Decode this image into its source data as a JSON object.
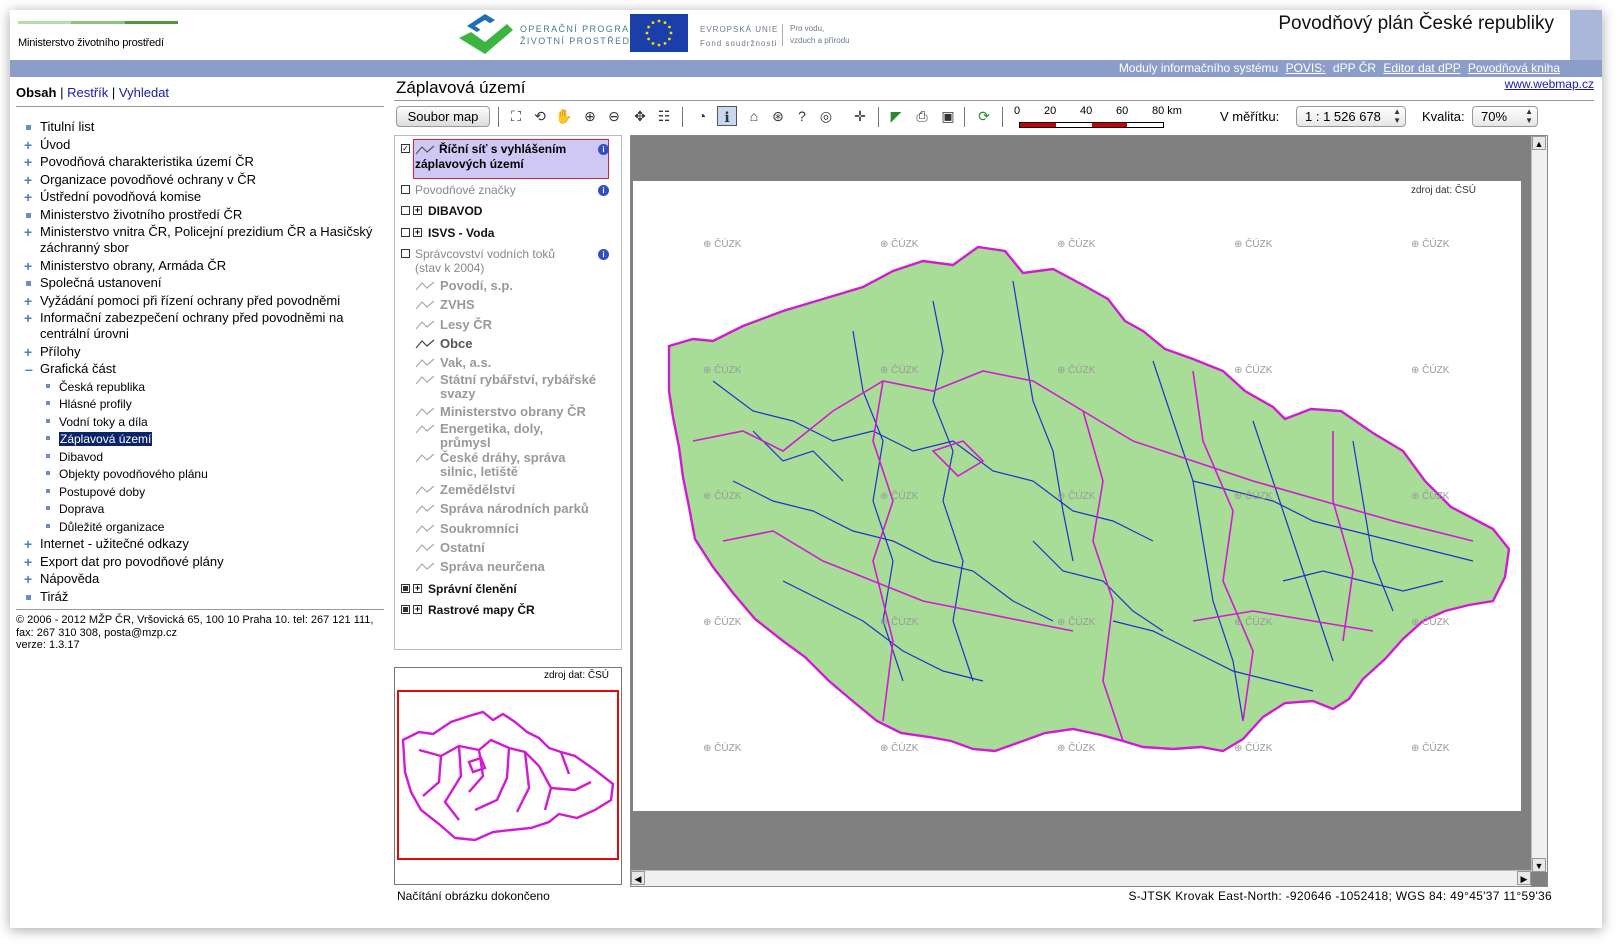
{
  "header": {
    "ministry_name": "Ministerstvo životního prostředí",
    "op_line1": "OPERAČNÍ PROGRAM",
    "op_line2": "ŽIVOTNÍ PROSTŘEDÍ",
    "eu_line1": "EVROPSKÁ UNIE",
    "eu_line2": "Fond soudržnosti",
    "eu_motto1": "Pro vodu,",
    "eu_motto2": "vzduch a přírodu",
    "app_title": "Povodňový plán České republiky",
    "colors": {
      "ministry_green": "#6ab04c",
      "nav_bar": "#8b9dc8",
      "eu_blue": "#1b3fa8"
    }
  },
  "topnav": {
    "prefix": "Moduly informačního systému",
    "povis": "POVIS:",
    "dpp": "dPP ČR",
    "editor": "Editor dat dPP",
    "kniha": "Povodňová kniha",
    "webmap": "www.webmap.cz"
  },
  "leftnav": {
    "tab_active": "Obsah",
    "sep": "|",
    "tab_restrik": "Restřík",
    "tab_search": "Vyhledat",
    "items": [
      {
        "label": "Titulní list",
        "marker": "bullet"
      },
      {
        "label": "Úvod",
        "marker": "plus"
      },
      {
        "label": "Povodňová charakteristika území ČR",
        "marker": "plus"
      },
      {
        "label": "Organizace povodňové ochrany v ČR",
        "marker": "plus"
      },
      {
        "label": "Ústřední povodňová komise",
        "marker": "plus"
      },
      {
        "label": "Ministerstvo životního prostředí ČR",
        "marker": "bullet"
      },
      {
        "label": "Ministerstvo vnitra ČR, Policejní prezidium ČR a Hasičský záchranný sbor",
        "marker": "plus"
      },
      {
        "label": "Ministerstvo obrany, Armáda ČR",
        "marker": "plus"
      },
      {
        "label": "Společná ustanovení",
        "marker": "bullet"
      },
      {
        "label": "Vyžádání pomoci při řízení ochrany před povodněmi",
        "marker": "plus"
      },
      {
        "label": "Informační zabezpečení ochrany před povodněmi na centrální úrovni",
        "marker": "plus"
      },
      {
        "label": "Přílohy",
        "marker": "plus"
      },
      {
        "label": "Grafická část",
        "marker": "minus"
      }
    ],
    "subitems": [
      "Česká republika",
      "Hlásné profily",
      "Vodní toky a díla",
      "Záplavová území",
      "Dibavod",
      "Objekty povodňového plánu",
      "Postupové doby",
      "Doprava",
      "Důležité organizace"
    ],
    "items_after": [
      {
        "label": "Internet - užitečné odkazy",
        "marker": "plus"
      },
      {
        "label": "Export dat pro povodňové plány",
        "marker": "plus"
      },
      {
        "label": "Nápověda",
        "marker": "plus"
      },
      {
        "label": "Tiráž",
        "marker": "bullet"
      }
    ],
    "footer_line1": "© 2006 - 2012 MŽP ČR, Vršovická 65, 100 10 Praha 10. tel: 267 121 111,",
    "footer_line2": "fax: 267 310 308, posta@mzp.cz",
    "footer_line3": "verze: 1.3.17"
  },
  "main": {
    "title": "Záplavová území",
    "soubor_map": "Soubor map",
    "scale_labels": [
      "0",
      "20",
      "40",
      "60",
      "80 km"
    ],
    "scale_label_lbl": "V měřítku:",
    "scale_value": "1 : 1 526 678",
    "quality_lbl": "Kvalita:",
    "quality_value": "70%"
  },
  "layers": {
    "rows": [
      {
        "label_1": "Říční síť s vyhlášením",
        "label_2": "záplavových území"
      },
      {
        "label": "Povodňové značky"
      },
      {
        "label": "DIBAVOD"
      },
      {
        "label": "ISVS - Voda"
      },
      {
        "label_1": "Správcovství vodních toků",
        "label_2": "(stav k 2004)"
      }
    ],
    "sub": [
      "Povodí, s.p.",
      "ZVHS",
      "Lesy ČR",
      "Obce",
      "Vak, a.s.",
      "Státní rybářství, rybářské",
      "svazy",
      "Ministerstvo obrany ČR",
      "Energetika, doly,",
      "průmysl",
      "České dráhy, správa",
      "silnic, letiště",
      "Zemědělství",
      "Správa národních parků",
      "Soukromníci",
      "Ostatní",
      "Správa neurčena"
    ],
    "bottom": [
      "Správní členění",
      "Rastrové mapy ČR"
    ]
  },
  "overview": {
    "src": "zdroj dat: ČSÚ"
  },
  "map": {
    "src": "zdroj dat: ČSÚ",
    "watermark": "⊕ ČÚZK",
    "colors": {
      "rivers": "#1a1acc",
      "boundaries": "#d21ad2",
      "land": "#9ddb8c"
    }
  },
  "status": {
    "left": "Načítání obrázku dokončeno",
    "right": "S-JTSK Krovak East-North: -920646 -1052418; WGS 84: 49°45'37 11°59'36"
  }
}
